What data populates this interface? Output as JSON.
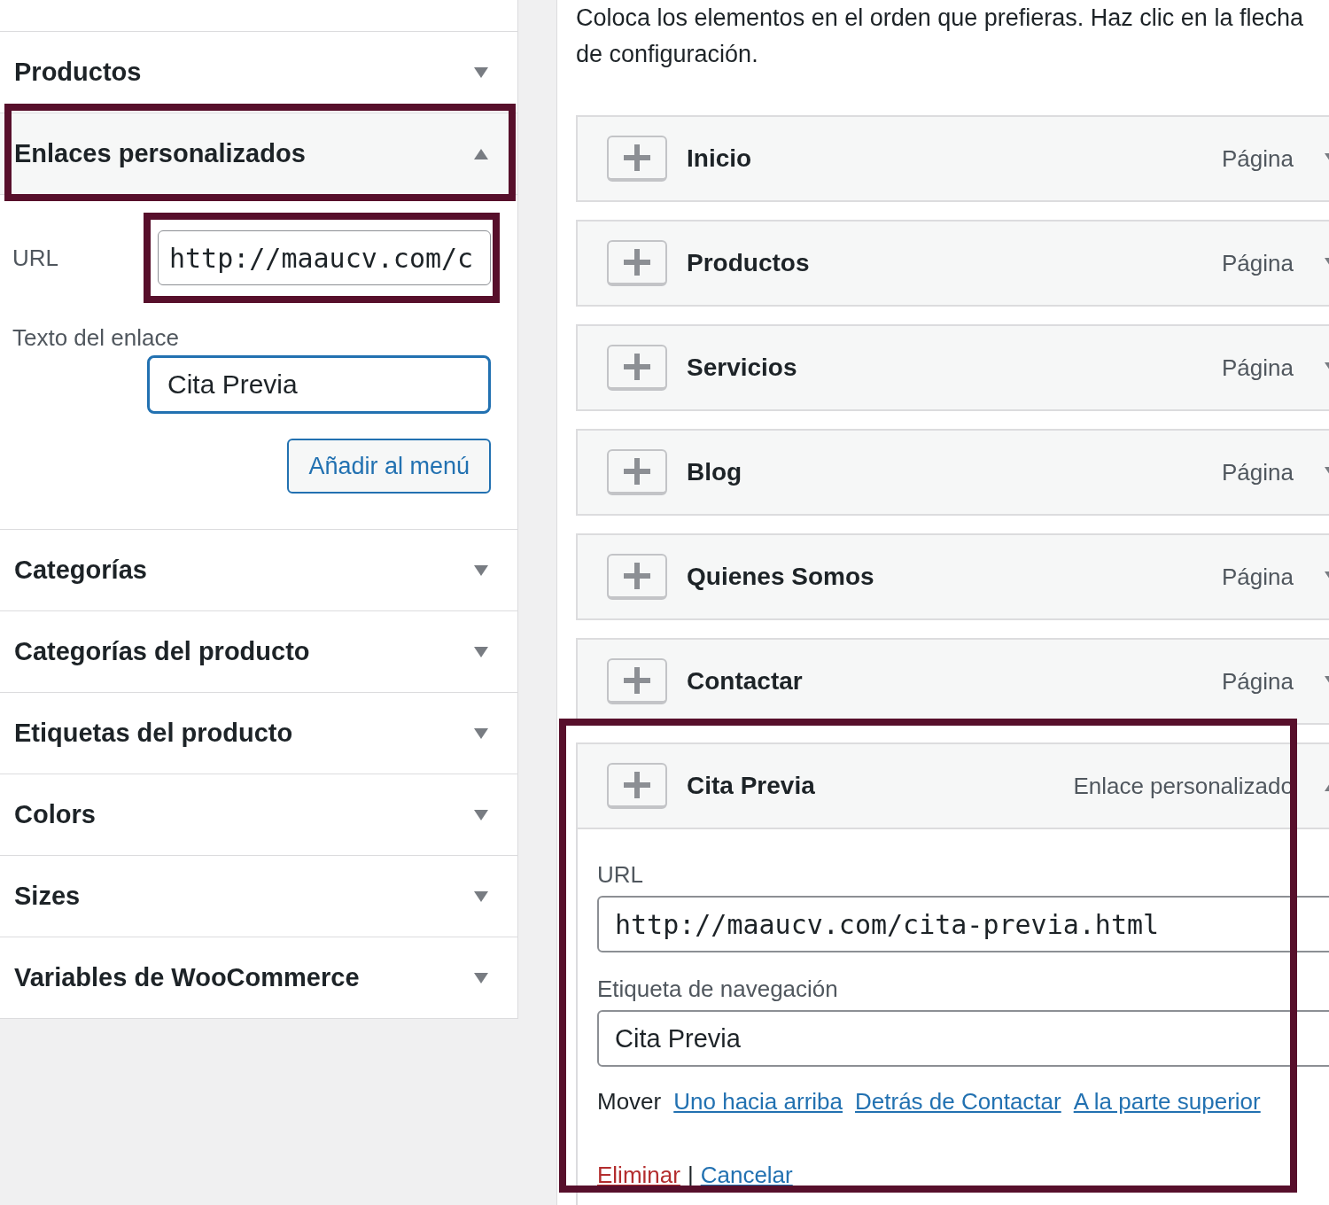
{
  "sidebar": {
    "sections": [
      {
        "title": "Productos",
        "expanded": false,
        "highlighted": false
      },
      {
        "title": "Enlaces personalizados",
        "expanded": true,
        "highlighted": true,
        "form": {
          "url_label": "URL",
          "url_value": "http://maaucv.com/c",
          "url_highlighted": true,
          "text_label": "Texto del enlace",
          "text_value": "Cita Previa",
          "text_focused": true,
          "button": "Añadir al menú"
        }
      },
      {
        "title": "Categorías",
        "expanded": false,
        "highlighted": false
      },
      {
        "title": "Categorías del producto",
        "expanded": false,
        "highlighted": false
      },
      {
        "title": "Etiquetas del producto",
        "expanded": false,
        "highlighted": false
      },
      {
        "title": "Colors",
        "expanded": false,
        "highlighted": false
      },
      {
        "title": "Sizes",
        "expanded": false,
        "highlighted": false
      },
      {
        "title": "Variables de WooCommerce",
        "expanded": false,
        "highlighted": false
      }
    ]
  },
  "menu": {
    "instructions": [
      "Coloca los elementos en el orden que prefieras. Haz clic en la flecha",
      "de configuración."
    ],
    "items": [
      {
        "title": "Inicio",
        "type": "Página",
        "expanded": false,
        "highlighted": false
      },
      {
        "title": "Productos",
        "type": "Página",
        "expanded": false,
        "highlighted": false
      },
      {
        "title": "Servicios",
        "type": "Página",
        "expanded": false,
        "highlighted": false
      },
      {
        "title": "Blog",
        "type": "Página",
        "expanded": false,
        "highlighted": false
      },
      {
        "title": "Quienes Somos",
        "type": "Página",
        "expanded": false,
        "highlighted": false
      },
      {
        "title": "Contactar",
        "type": "Página",
        "expanded": false,
        "highlighted": false
      },
      {
        "title": "Cita Previa",
        "type": "Enlace personalizado",
        "expanded": true,
        "highlighted": true,
        "settings": {
          "url_label": "URL",
          "url_value": "http://maaucv.com/cita-previa.html",
          "nav_label": "Etiqueta de navegación",
          "nav_value": "Cita Previa",
          "move_label": "Mover",
          "move_links": [
            "Uno hacia arriba",
            "Detrás de Contactar",
            "A la parte superior"
          ],
          "delete": "Eliminar",
          "separator": "|",
          "cancel": "Cancelar"
        }
      }
    ]
  }
}
